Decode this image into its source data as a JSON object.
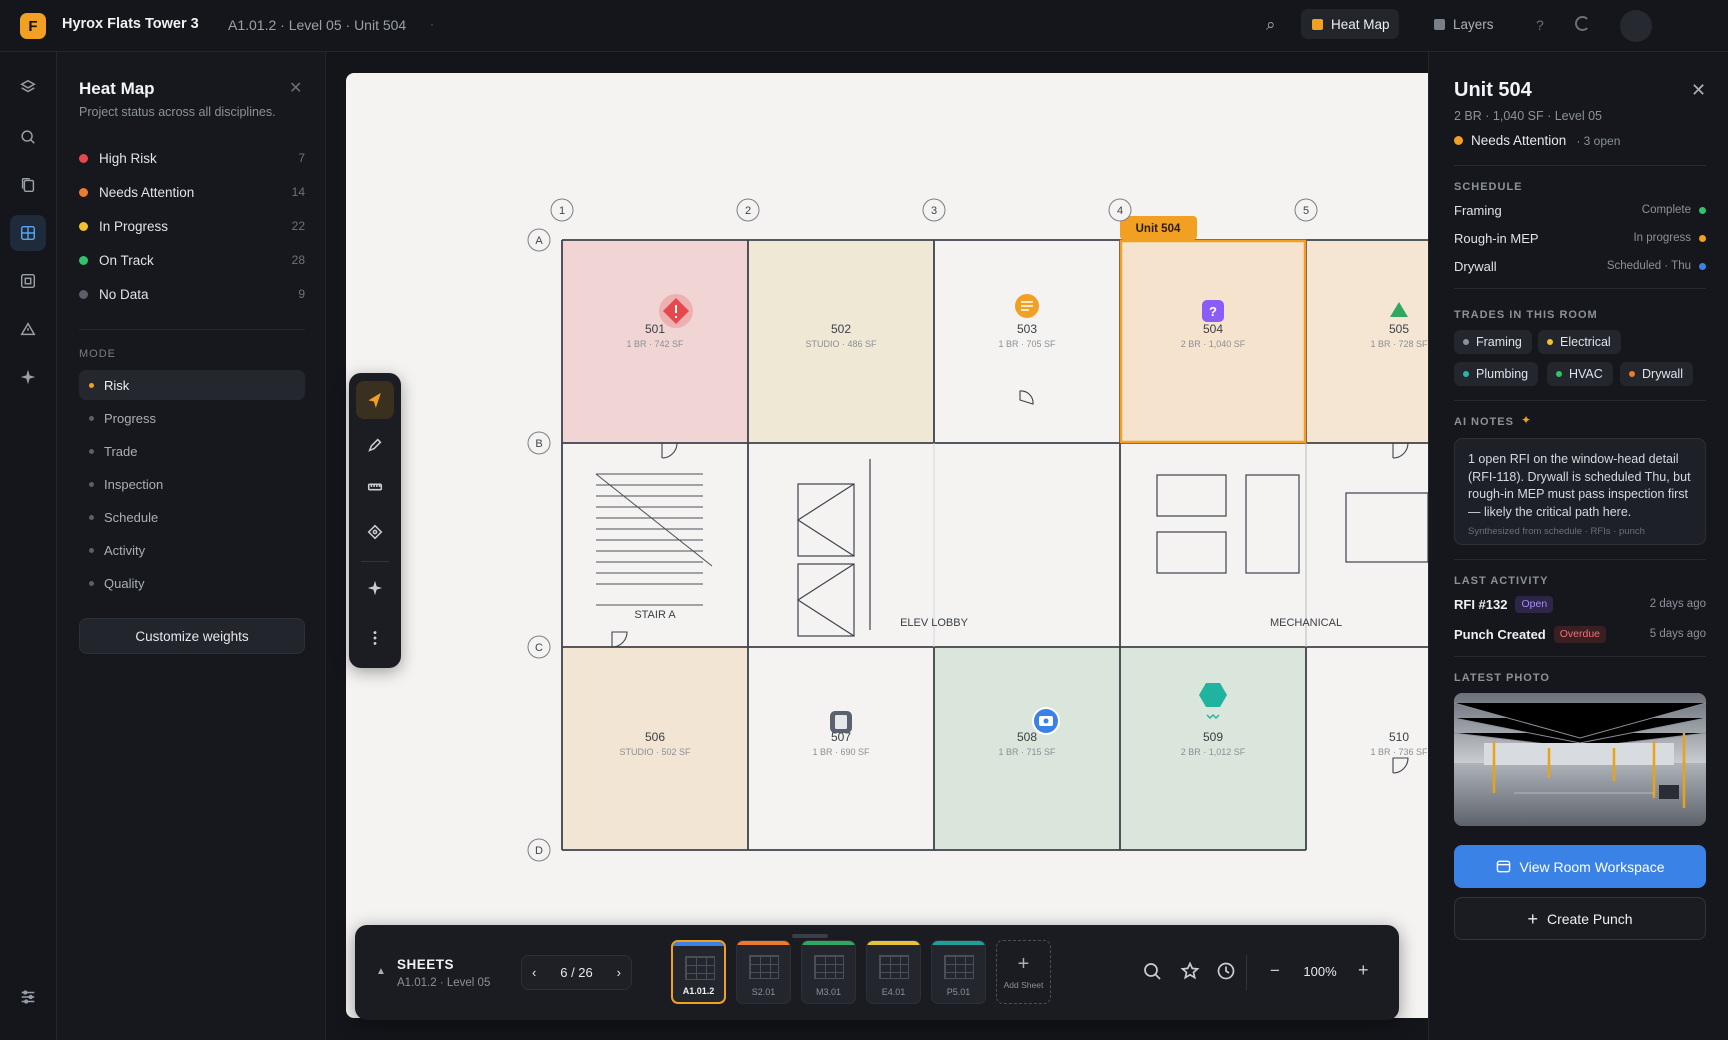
{
  "topbar": {
    "logo_letter": "F",
    "project": "Hyrox Flats Tower 3",
    "breadcrumb": "A1.01.2 · Level 05 · Unit 504",
    "heat_map_label": "Heat Map",
    "layers_label": "Layers",
    "help": "?",
    "accent": "#f2a024"
  },
  "heatmap_panel": {
    "title": "Heat Map",
    "subtitle": "Project status across all disciplines.",
    "legend": [
      {
        "label": "High Risk",
        "count": "7",
        "color": "#e5484d"
      },
      {
        "label": "Needs Attention",
        "count": "14",
        "color": "#f07a2a"
      },
      {
        "label": "In Progress",
        "count": "22",
        "color": "#f2c12e"
      },
      {
        "label": "On Track",
        "count": "28",
        "color": "#30c36b"
      },
      {
        "label": "No Data",
        "count": "9",
        "color": "#5a5f69"
      }
    ],
    "mode_label": "MODE",
    "modes": [
      "Risk",
      "Progress",
      "Trade",
      "Inspection",
      "Schedule",
      "Activity",
      "Quality"
    ],
    "active_mode": "Risk",
    "customize_label": "Customize weights"
  },
  "plan": {
    "grid_columns": [
      "1",
      "2",
      "3",
      "4",
      "5"
    ],
    "grid_rows": [
      "A",
      "B",
      "C",
      "D"
    ],
    "selected_tag": "Unit 504",
    "units": [
      {
        "num": "501",
        "desc": "1 BR · 742 SF"
      },
      {
        "num": "502",
        "desc": "STUDIO · 486 SF"
      },
      {
        "num": "503",
        "desc": "1 BR · 705 SF"
      },
      {
        "num": "504",
        "desc": "2 BR · 1,040 SF"
      },
      {
        "num": "505",
        "desc": "1 BR · 728 SF"
      },
      {
        "num": "506",
        "desc": "STUDIO · 502 SF"
      },
      {
        "num": "507",
        "desc": "1 BR · 690 SF"
      },
      {
        "num": "508",
        "desc": "1 BR · 715 SF"
      },
      {
        "num": "509",
        "desc": "2 BR · 1,012 SF"
      },
      {
        "num": "510",
        "desc": "1 BR · 736 SF"
      }
    ],
    "core_labels": {
      "stair": "STAIR A",
      "elev": "ELEV LOBBY",
      "mech": "MECHANICAL"
    },
    "marker_504": "?"
  },
  "sheets": {
    "title": "SHEETS",
    "subtitle": "A1.01.2 · Level 05",
    "page": "6 / 26",
    "thumbs": [
      {
        "label": "A1.01.2",
        "color": "#3b82e6"
      },
      {
        "label": "S2.01",
        "color": "#f07a2a"
      },
      {
        "label": "M3.01",
        "color": "#30a860"
      },
      {
        "label": "E4.01",
        "color": "#e8c23a"
      },
      {
        "label": "P5.01",
        "color": "#1f9e9a"
      }
    ],
    "add_label": "Add Sheet",
    "zoom": "100%"
  },
  "unit_panel": {
    "title": "Unit 504",
    "subtitle": "2 BR · 1,040 SF · Level 05",
    "status": "Needs Attention",
    "open_count": "· 3 open",
    "schedule_label": "SCHEDULE",
    "schedule": [
      {
        "task": "Framing",
        "state": "Complete",
        "color": "#30c36b"
      },
      {
        "task": "Rough-in MEP",
        "state": "In progress",
        "color": "#f2a024"
      },
      {
        "task": "Drywall",
        "state": "Scheduled · Thu",
        "color": "#3b82e6"
      }
    ],
    "trades_label": "TRADES IN THIS ROOM",
    "trades": [
      {
        "name": "Framing",
        "color": "#8b919b"
      },
      {
        "name": "Electrical",
        "color": "#f2c12e"
      },
      {
        "name": "Plumbing",
        "color": "#2bb3a8"
      },
      {
        "name": "HVAC",
        "color": "#30c36b"
      },
      {
        "name": "Drywall",
        "color": "#f07a2a"
      }
    ],
    "ai_label": "AI NOTES",
    "ai_text": "1 open RFI on the window-head detail (RFI-118). Drywall is scheduled Thu, but rough-in MEP must pass inspection first — likely the critical path here.",
    "ai_source": "Synthesized from schedule · RFIs · punch",
    "activity_label": "LAST ACTIVITY",
    "activity": [
      {
        "title": "RFI #132",
        "badge": "Open",
        "when": "2 days ago"
      },
      {
        "title": "Punch Created",
        "badge": "Overdue",
        "when": "5 days ago"
      }
    ],
    "photo_label": "LATEST PHOTO",
    "view_label": "View Room Workspace",
    "punch_label": "Create Punch"
  }
}
